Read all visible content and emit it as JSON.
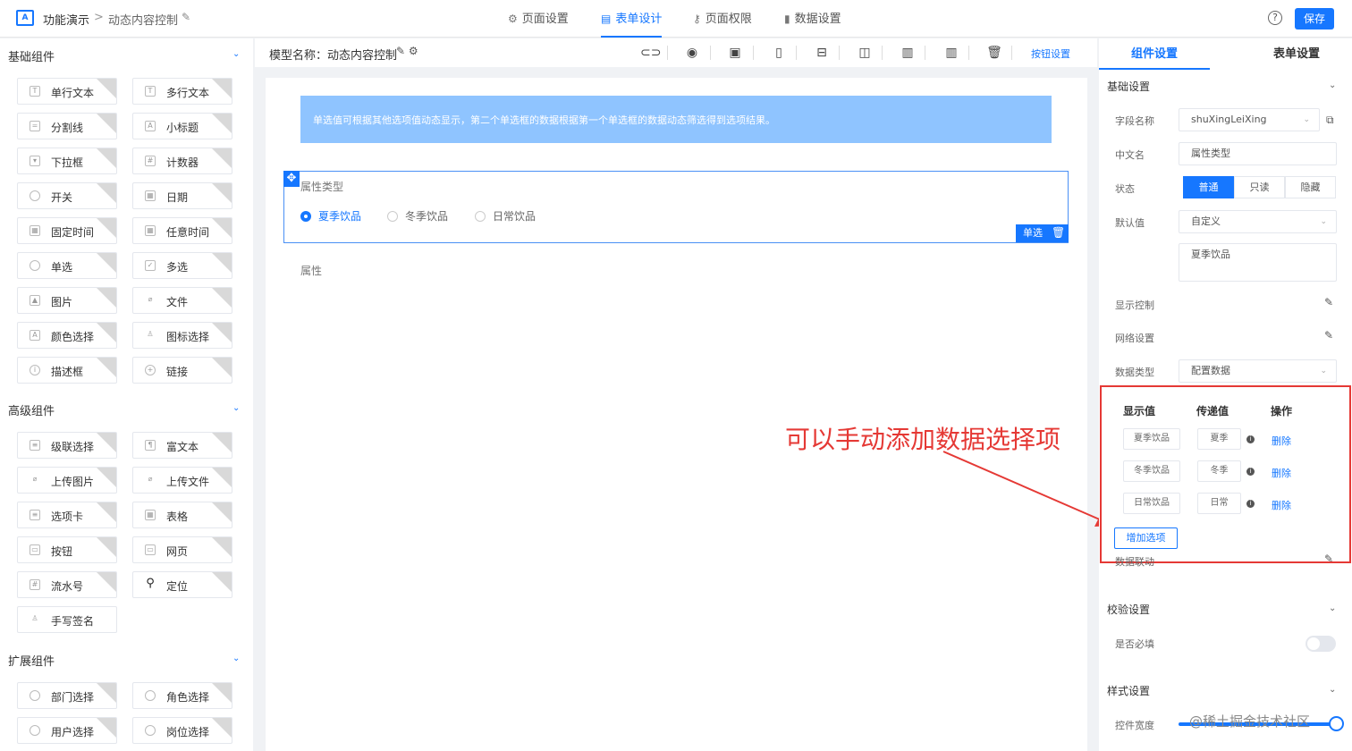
{
  "topbar": {
    "app_title": "功能演示",
    "crumb_sep": ">",
    "crumb": "动态内容控制",
    "tabs": [
      {
        "icon": "⚙",
        "label": "页面设置"
      },
      {
        "icon": "▤",
        "label": "表单设计"
      },
      {
        "icon": "⚷",
        "label": "页面权限"
      },
      {
        "icon": "▮",
        "label": "数据设置"
      }
    ],
    "help": "?",
    "save": "保存"
  },
  "palette": {
    "basic_title": "基础组件",
    "basic": [
      "单行文本",
      "多行文本",
      "分割线",
      "小标题",
      "下拉框",
      "计数器",
      "开关",
      "日期",
      "固定时间",
      "任意时间",
      "单选",
      "多选",
      "图片",
      "文件",
      "颜色选择",
      "图标选择",
      "描述框",
      "链接"
    ],
    "advanced_title": "高级组件",
    "advanced": [
      "级联选择",
      "富文本",
      "上传图片",
      "上传文件",
      "选项卡",
      "表格",
      "按钮",
      "网页",
      "流水号",
      "定位",
      "手写签名"
    ],
    "extended_title": "扩展组件",
    "extended": [
      "部门选择",
      "角色选择",
      "用户选择",
      "岗位选择"
    ]
  },
  "canvas": {
    "model_name": "模型名称：动态内容控制",
    "btn_settings": "按钮设置",
    "notice": "单选值可根据其他选项值动态显示，第二个单选框的数据根据第一个单选框的数据动态筛选得到选项结果。",
    "field_label": "属性类型",
    "radios": [
      "夏季饮品",
      "冬季饮品",
      "日常饮品"
    ],
    "selected_radio": "夏季饮品",
    "field_badge": "单选",
    "prop_label": "属性"
  },
  "annotation": {
    "text": "可以手动添加数据选择项",
    "color": "#e53935"
  },
  "right": {
    "tab_component": "组件设置",
    "tab_form": "表单设置",
    "basic_section": "基础设置",
    "field_name_label": "字段名称",
    "field_name_value": "shuXingLeiXing",
    "cn_name_label": "中文名",
    "cn_name_value": "属性类型",
    "status_label": "状态",
    "status_options": [
      "普通",
      "只读",
      "隐藏"
    ],
    "default_label": "默认值",
    "default_value": "自定义",
    "default_text": "夏季饮品",
    "display_ctrl": "显示控制",
    "grid_setting": "网络设置",
    "data_type_label": "数据类型",
    "data_type_value": "配置数据",
    "table_headers": [
      "显示值",
      "传递值",
      "操作"
    ],
    "rows": [
      {
        "display": "夏季饮品",
        "value": "夏季",
        "action": "删除"
      },
      {
        "display": "冬季饮品",
        "value": "冬季",
        "action": "删除"
      },
      {
        "display": "日常饮品",
        "value": "日常",
        "action": "删除"
      }
    ],
    "add_option": "增加选项",
    "data_linkage": "数据联动",
    "validate_section": "校验设置",
    "required_label": "是否必填",
    "style_section": "样式设置",
    "width_label": "控件宽度",
    "watermark": "@稀土掘金技术社区"
  },
  "colors": {
    "accent": "#1677ff",
    "notice_bg": "#8fc4ff",
    "annotation": "#e53935"
  }
}
